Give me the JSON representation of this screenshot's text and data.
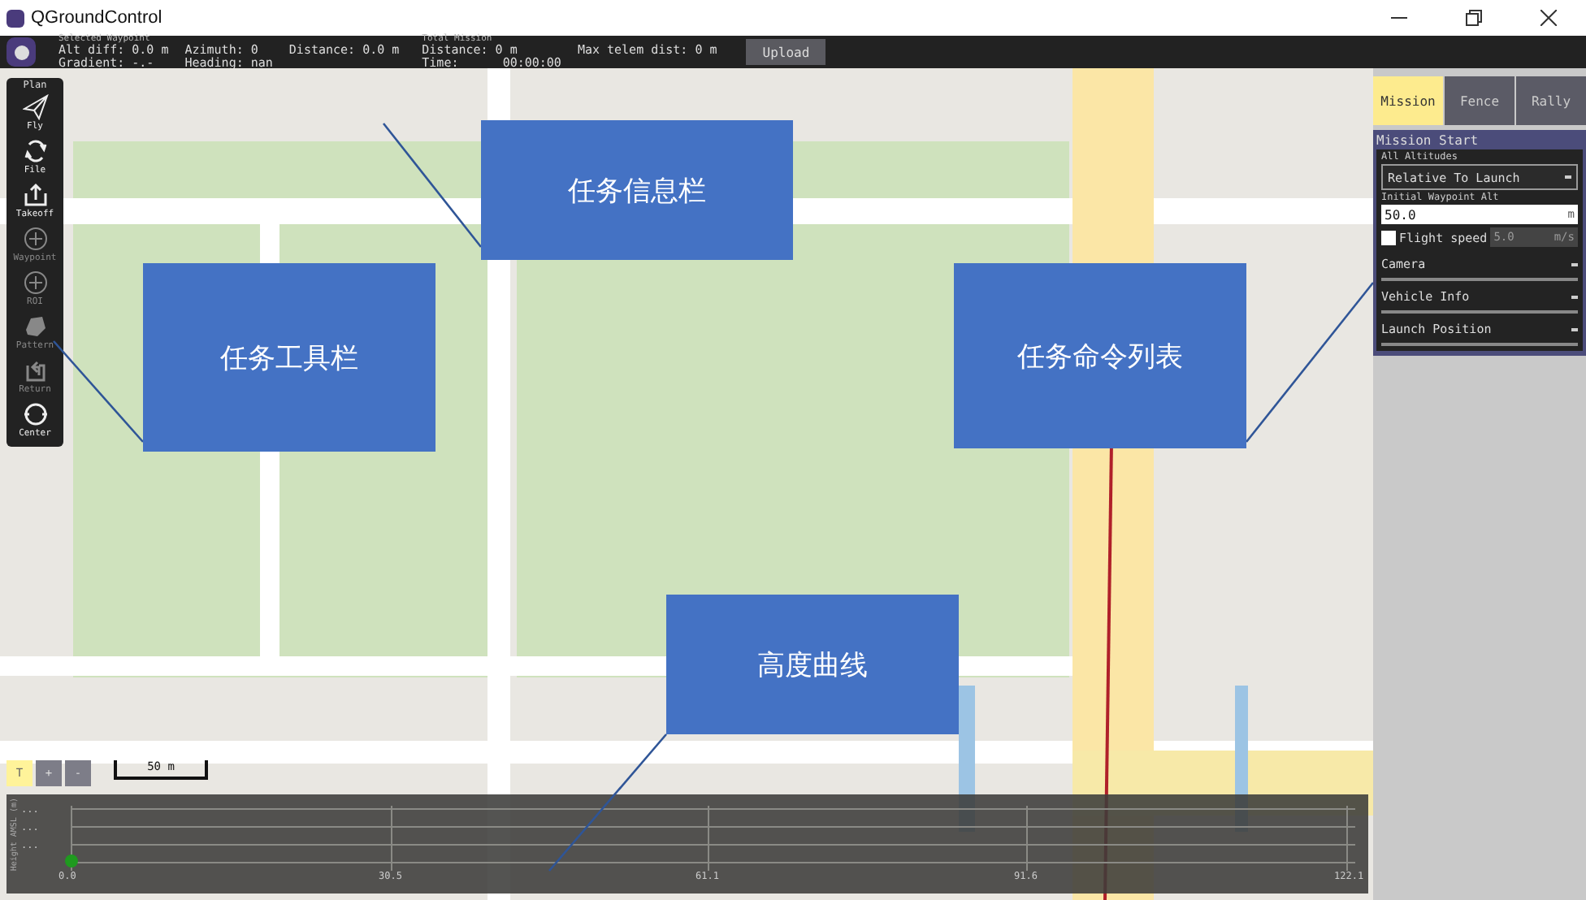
{
  "window": {
    "title": "QGroundControl"
  },
  "info_bar": {
    "selected_waypoint": {
      "heading": "Selected Waypoint",
      "fields": [
        [
          "Alt diff: 0.0 m",
          "Gradient: -.-"
        ],
        [
          "Azimuth: 0",
          "Heading: nan"
        ],
        [
          "Distance: 0.0 m"
        ]
      ]
    },
    "total_mission": {
      "heading": "Total Mission",
      "fields": [
        [
          "Distance: 0 m",
          "Time:      00:00:00"
        ],
        [
          "Max telem dist: 0 m"
        ]
      ]
    },
    "upload_button": "Upload"
  },
  "toolbar": {
    "title": "Plan",
    "items": [
      {
        "label": "Fly",
        "kind": "plane",
        "disabled": false
      },
      {
        "label": "File",
        "kind": "sync",
        "disabled": false
      },
      {
        "label": "Takeoff",
        "kind": "takeoff",
        "disabled": false
      },
      {
        "label": "Waypoint",
        "kind": "plus",
        "disabled": true
      },
      {
        "label": "ROI",
        "kind": "plus",
        "disabled": true
      },
      {
        "label": "Pattern",
        "kind": "pattern",
        "disabled": true
      },
      {
        "label": "Return",
        "kind": "return",
        "disabled": true
      },
      {
        "label": "Center",
        "kind": "center",
        "disabled": false
      }
    ]
  },
  "map_controls": {
    "buttons": [
      "T",
      "+",
      "-"
    ],
    "scale": "50 m"
  },
  "tabs": [
    {
      "label": "Mission",
      "selected": true
    },
    {
      "label": "Fence",
      "selected": false
    },
    {
      "label": "Rally",
      "selected": false
    }
  ],
  "mission_start": {
    "title": "Mission Start",
    "altitudes_label": "All Altitudes",
    "altitudes_value": "Relative To Launch",
    "initial_alt_label": "Initial Waypoint Alt",
    "initial_alt_value": "50.0",
    "initial_alt_unit": "m",
    "flight_speed": {
      "label": "Flight speed",
      "checked": false,
      "value": "5.0",
      "unit": "m/s"
    },
    "sections": [
      {
        "label": "Camera",
        "expanded": false
      },
      {
        "label": "Vehicle Info",
        "expanded": false
      },
      {
        "label": "Launch Position",
        "expanded": false
      }
    ]
  },
  "height_chart": {
    "axis_label": "Height AMSL (m)",
    "y_tick_labels": [
      "...",
      "...",
      "..."
    ],
    "x_tick_labels": [
      "0.0",
      "30.5",
      "61.1",
      "91.6",
      "122.1"
    ]
  },
  "callouts": [
    {
      "text": "任务信息栏"
    },
    {
      "text": "任务工具栏"
    },
    {
      "text": "任务命令列表"
    },
    {
      "text": "高度曲线"
    }
  ]
}
